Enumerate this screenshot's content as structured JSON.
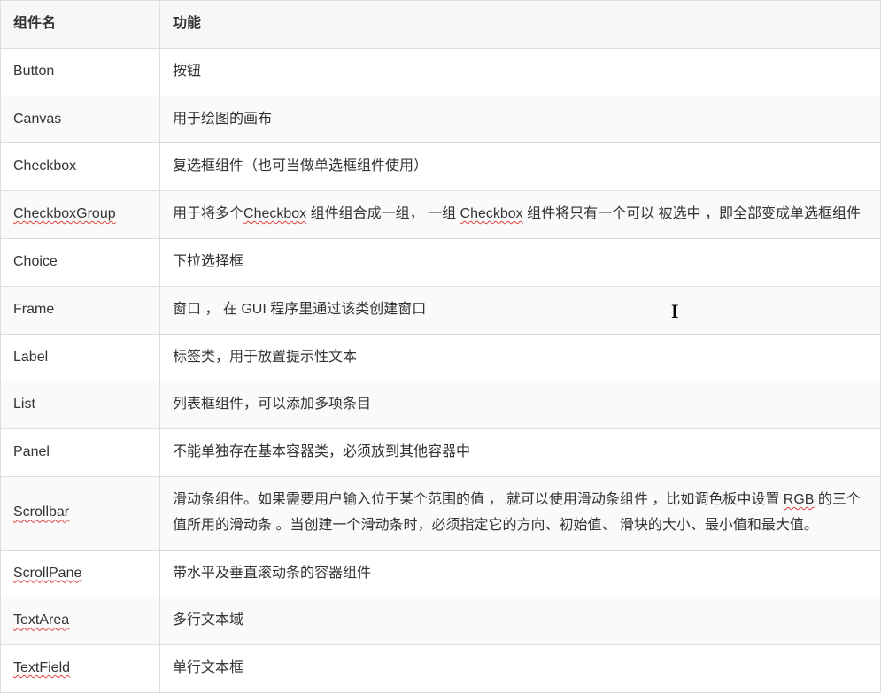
{
  "header": {
    "col1": "组件名",
    "col2": "功能"
  },
  "rows": [
    {
      "name": "Button",
      "spell": false,
      "descRaw": "按钮"
    },
    {
      "name": "Canvas",
      "spell": false,
      "descRaw": "用于绘图的画布"
    },
    {
      "name": "Checkbox",
      "spell": false,
      "descRaw": "复选框组件（也可当做单选框组件使用）"
    },
    {
      "name": "CheckboxGroup",
      "spell": true,
      "descRaw": "用于将多个{Checkbox} 组件组合成一组， 一组 {Checkbox} 组件将只有一个可以 被选中 ，即全部变成单选框组件"
    },
    {
      "name": "Choice",
      "spell": false,
      "descRaw": "下拉选择框"
    },
    {
      "name": "Frame",
      "spell": false,
      "descRaw": "窗口 ， 在 GUI 程序里通过该类创建窗口"
    },
    {
      "name": "Label",
      "spell": false,
      "descRaw": "标签类，用于放置提示性文本"
    },
    {
      "name": "List",
      "spell": false,
      "descRaw": "列表框组件，可以添加多项条目"
    },
    {
      "name": "Panel",
      "spell": false,
      "descRaw": "不能单独存在基本容器类，必须放到其他容器中"
    },
    {
      "name": "Scrollbar",
      "spell": true,
      "descRaw": "滑动条组件。如果需要用户输入位于某个范围的值 ， 就可以使用滑动条组件 ，比如调色板中设置 {RGB} 的三个值所用的滑动条 。当创建一个滑动条时，必须指定它的方向、初始值、 滑块的大小、最小值和最大值。"
    },
    {
      "name": "ScrollPane",
      "spell": true,
      "descRaw": "带水平及垂直滚动条的容器组件"
    },
    {
      "name": "TextArea",
      "spell": true,
      "descRaw": "多行文本域"
    },
    {
      "name": "TextField",
      "spell": true,
      "descRaw": "单行文本框"
    }
  ],
  "cursor": "I"
}
